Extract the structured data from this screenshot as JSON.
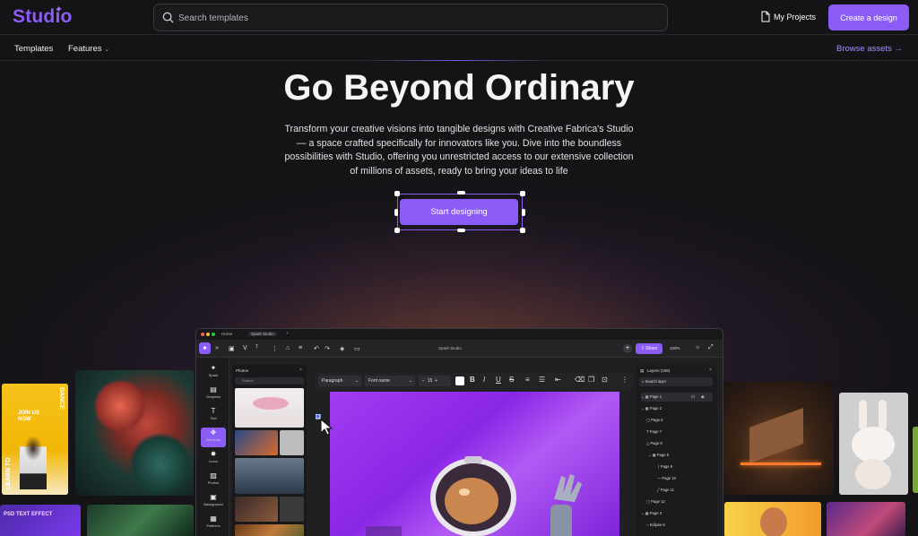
{
  "brand": {
    "name": "Studio",
    "accent": "#8b5cf6"
  },
  "search": {
    "placeholder": "Search templates"
  },
  "header": {
    "my_projects": "My Projects",
    "create_design": "Create a design"
  },
  "nav": {
    "templates": "Templates",
    "features": "Features",
    "browse_assets": "Browse assets"
  },
  "hero": {
    "title": "Go Beyond Ordinary",
    "description": "Transform your creative visions into tangible designs with Creative Fabrica's Studio — a space crafted specifically for innovators like you. Dive into the boundless possibilities with Studio, offering you unrestricted access to our extensive collection of millions of assets, ready to bring your ideas to life",
    "cta": "Start designing"
  },
  "side_tiles": {
    "flyer_left": "LEARN TO",
    "flyer_join": "JOIN US NOW",
    "flyer_dance": "DANCE",
    "psd_text": "PSD TEXT EFFECT"
  },
  "app": {
    "tabs": [
      "Home",
      "Spark Studio"
    ],
    "doc_title": "Spark Studio",
    "share": "Share",
    "zoom": "100%",
    "rail": [
      "Spark",
      "Graphics",
      "Text",
      "Elements",
      "Icons",
      "Photos",
      "Background",
      "Patterns"
    ],
    "panel_title": "Photos",
    "panel_search": "Search",
    "format": {
      "style": "Paragraph",
      "font": "Font name",
      "size": "15"
    },
    "layers_title": "Layers (156)",
    "layers_search": "Search layer",
    "layers": [
      "Page 1",
      "Page 2",
      "Page 6",
      "Page 7",
      "Page 8",
      "Page 5",
      "Page 9",
      "Page 10",
      "Page 11",
      "Page 12",
      "Page 3",
      "Eclipse 6"
    ]
  }
}
